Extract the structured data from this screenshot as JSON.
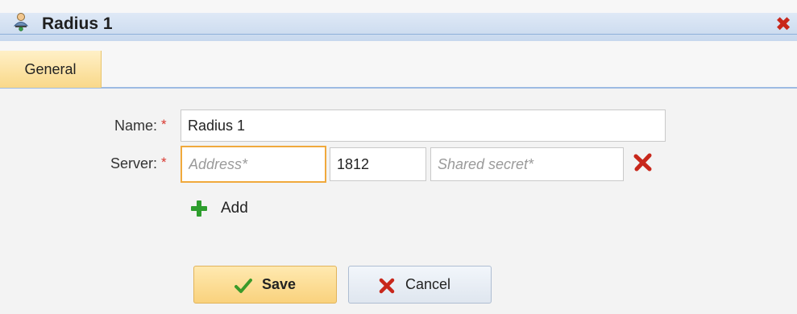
{
  "window": {
    "title": "Radius 1",
    "title_icon": "user-network-icon",
    "close_icon": "close-x-icon"
  },
  "tabs": [
    {
      "label": "General",
      "active": true
    }
  ],
  "form": {
    "name": {
      "label": "Name:",
      "required_mark": "*",
      "value": "Radius 1"
    },
    "server": {
      "label": "Server:",
      "required_mark": "*",
      "address_placeholder": "Address*",
      "address_value": "",
      "port_value": "1812",
      "secret_placeholder": "Shared secret*",
      "secret_value": "",
      "remove_icon": "remove-x-icon"
    },
    "add": {
      "label": "Add",
      "icon": "plus-icon"
    }
  },
  "actions": {
    "save_label": "Save",
    "save_icon": "checkmark-icon",
    "cancel_label": "Cancel",
    "cancel_icon": "x-icon"
  },
  "colors": {
    "accent_tab": "#f9d889",
    "title_band": "#c7d8ee",
    "required": "#d9372f",
    "remove": "#c8271b",
    "add": "#2e9e2e",
    "focus_border": "#f0a93c"
  }
}
